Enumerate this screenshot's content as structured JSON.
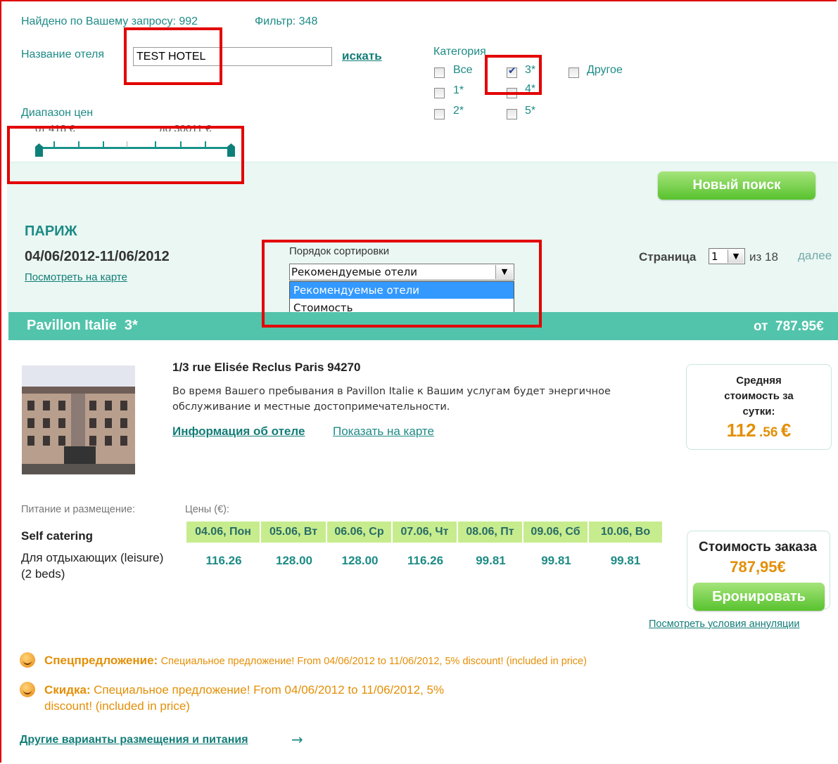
{
  "search": {
    "found_text": "Найдено по Вашему запросу: 992",
    "filter_text": "Фильтр: 348",
    "hotel_name_label": "Название отеля",
    "hotel_name_value": "TEST HOTEL",
    "search_link": "искать"
  },
  "category": {
    "title": "Категория",
    "options": [
      {
        "label": "Все",
        "checked": false
      },
      {
        "label": "3*",
        "checked": true
      },
      {
        "label": "Другое",
        "checked": false
      },
      {
        "label": "1*",
        "checked": false
      },
      {
        "label": "4*",
        "checked": false
      },
      {
        "label": "2*",
        "checked": false
      },
      {
        "label": "5*",
        "checked": false
      }
    ]
  },
  "price_range": {
    "label": "Диапазон цен",
    "from_text": "от 418 €",
    "to_text": "до 30011 €"
  },
  "new_search_button": "Новый поиск",
  "destination": {
    "city": "ПАРИЖ",
    "dates": "04/06/2012-11/06/2012",
    "map_link": "Посмотреть на карте"
  },
  "sort": {
    "label": "Порядок сортировки",
    "selected": "Рекомендуемые отели",
    "options": [
      "Рекомендуемые отели",
      "Стоимость"
    ]
  },
  "pagination": {
    "page_label": "Страница",
    "current_page": "1",
    "total_text": "из 18",
    "next_link": "далее"
  },
  "hotel": {
    "name": "Pavillon Italie  3*",
    "from_price": "от  787.95€",
    "address": "1/3 rue Elisée Reclus Paris 94270",
    "description_line1": "Во время Вашего пребывания в Pavillon Italie к Вашим услугам будет энергичное",
    "description_line2": "обслуживание и местные достопримечательности.",
    "info_link": "Информация об отеле",
    "map_link": "Показать на карте",
    "avg_cost_label_1": "Средняя",
    "avg_cost_label_2": "стоимость за",
    "avg_cost_label_3": "сутки:",
    "avg_cost_main": "112",
    "avg_cost_cents": ".56",
    "avg_cost_currency": "€"
  },
  "rates": {
    "meal_label": "Питание и размещение:",
    "prices_label": "Цены (€):",
    "board": "Self catering",
    "room_line1": "Для отдыхающих (leisure)",
    "room_line2": "(2 beds)",
    "dates": [
      "04.06, Пон",
      "05.06, Вт",
      "06.06, Ср",
      "07.06, Чт",
      "08.06, Пт",
      "09.06, Сб",
      "10.06, Во"
    ],
    "prices": [
      "116.26",
      "128.00",
      "128.00",
      "116.26",
      "99.81",
      "99.81",
      "99.81"
    ]
  },
  "order": {
    "title": "Стоимость заказа",
    "total": "787,95€",
    "book_button": "Бронировать",
    "cancel_link": "Посмотреть условия аннуляции"
  },
  "offers": {
    "special_title": "Спецпредложение:",
    "special_text": "Специальное предложение! From 04/06/2012 to 11/06/2012, 5% discount! (included in price)",
    "discount_title": "Скидка:",
    "discount_text_line1": "Специальное предложение! From 04/06/2012 to 11/06/2012, 5%",
    "discount_text_line2": "discount! (included in price)"
  },
  "other_options_link": "Другие варианты размещения и питания",
  "other_options_arrow": "→",
  "colors": {
    "teal": "#1d8b86",
    "band": "#52c4ab",
    "highlight_red": "#e30000",
    "orange": "#e38f06",
    "date_header_bg": "#c7ec8e"
  }
}
